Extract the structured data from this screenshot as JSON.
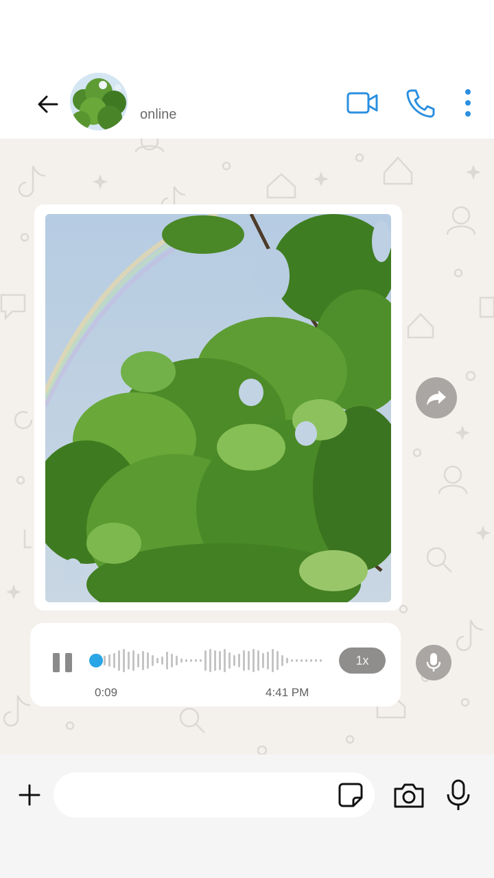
{
  "header": {
    "contact_status": "online",
    "icons": {
      "back": "back-arrow-icon",
      "video": "video-camera-icon",
      "call": "phone-icon",
      "more": "more-vertical-icon"
    },
    "accent_color": "#2a8fe0"
  },
  "chat": {
    "image_message": {
      "content": "photo of green tree leaves with rainbow in sky"
    },
    "voice_message": {
      "duration": "0:09",
      "time": "4:41 PM",
      "speed": "1x",
      "progress": 0.0,
      "play_state": "playing",
      "progress_color": "#2aa5e6"
    },
    "icons": {
      "forward": "forward-icon",
      "mic_small": "microphone-icon"
    }
  },
  "composer": {
    "placeholder": "",
    "icons": {
      "plus": "plus-icon",
      "sticker": "sticker-icon",
      "camera": "camera-icon",
      "mic": "microphone-icon"
    }
  }
}
